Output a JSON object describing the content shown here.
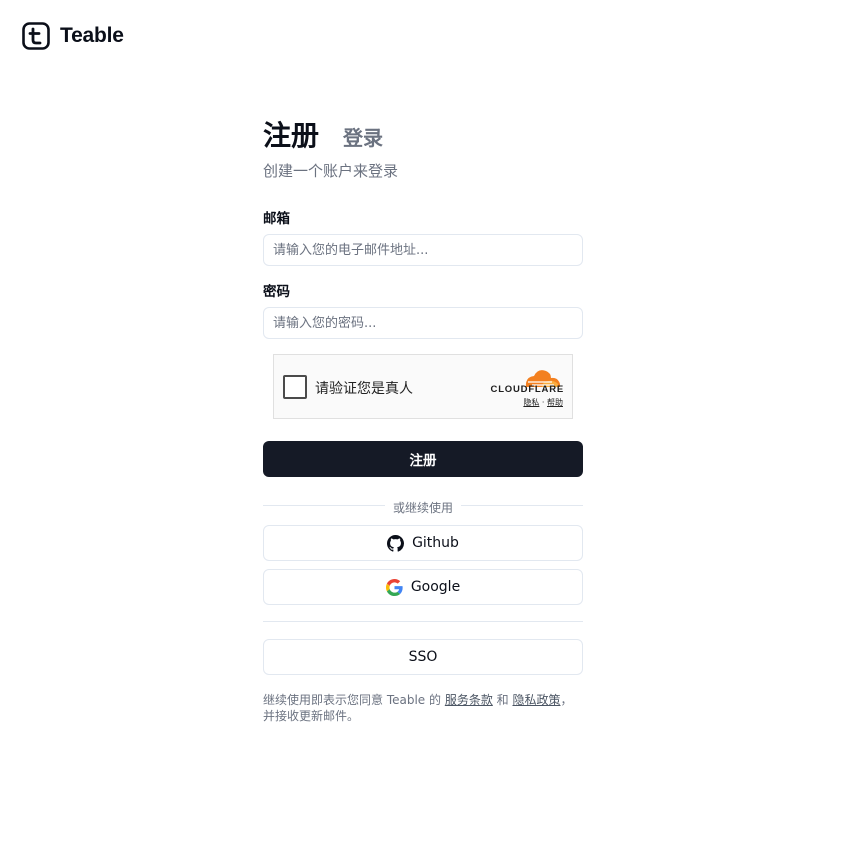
{
  "app": {
    "name": "Teable"
  },
  "tabs": {
    "signup": "注册",
    "login": "登录"
  },
  "subtitle": "创建一个账户来登录",
  "email": {
    "label": "邮箱",
    "placeholder": "请输入您的电子邮件地址..."
  },
  "password": {
    "label": "密码",
    "placeholder": "请输入您的密码..."
  },
  "captcha": {
    "label": "请验证您是真人",
    "brand": "CLOUDFLARE",
    "privacy": "隐私",
    "separator": "·",
    "help": "帮助"
  },
  "submit_label": "注册",
  "divider_text": "或继续使用",
  "oauth": {
    "github": "Github",
    "google": "Google"
  },
  "sso_label": "SSO",
  "terms": {
    "prefix": "继续使用即表示您同意 Teable 的 ",
    "tos": "服务条款",
    "and": " 和 ",
    "privacy": "隐私政策",
    "suffix": "，并接收更新邮件。"
  },
  "icons": {
    "logo": "teable-logo-icon",
    "github": "github-icon",
    "google": "google-icon",
    "cloudflare": "cloudflare-cloud-icon"
  },
  "colors": {
    "primary": "#151a26",
    "muted": "#6b7280",
    "border": "#e2e8f0",
    "cloudflare_orange": "#f38020"
  }
}
